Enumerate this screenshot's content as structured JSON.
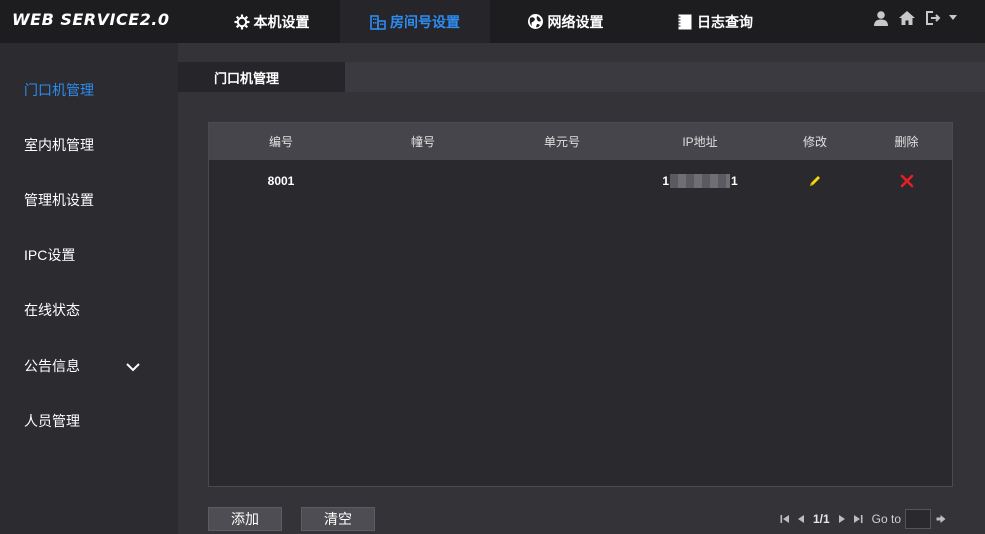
{
  "app": {
    "title": "WEB SERVICE2.0"
  },
  "topnav": [
    {
      "label": "本机设置",
      "icon": "gear-icon",
      "active": false
    },
    {
      "label": "房间号设置",
      "icon": "building-icon",
      "active": true
    },
    {
      "label": "网络设置",
      "icon": "globe-icon",
      "active": false
    },
    {
      "label": "日志查询",
      "icon": "log-icon",
      "active": false
    }
  ],
  "topright": {
    "icons": [
      "user-icon",
      "home-icon",
      "logout-icon",
      "caret-down-icon"
    ]
  },
  "sidebar": {
    "items": [
      {
        "label": "门口机管理",
        "active": true
      },
      {
        "label": "室内机管理",
        "active": false
      },
      {
        "label": "管理机设置",
        "active": false
      },
      {
        "label": "IPC设置",
        "active": false
      },
      {
        "label": "在线状态",
        "active": false
      },
      {
        "label": "公告信息",
        "active": false,
        "expandable": true
      },
      {
        "label": "人员管理",
        "active": false
      }
    ]
  },
  "main": {
    "tab": "门口机管理",
    "table": {
      "columns": [
        "编号",
        "幢号",
        "单元号",
        "IP地址",
        "修改",
        "删除"
      ],
      "rows": [
        {
          "id": "8001",
          "building": "",
          "unit": "",
          "ip_prefix": "1",
          "ip_suffix": "1"
        }
      ]
    },
    "buttons": {
      "add": "添加",
      "clear": "清空"
    },
    "pager": {
      "page": "1/1",
      "goto_label": "Go to",
      "goto_value": ""
    }
  },
  "colors": {
    "accent": "#2d8cf0",
    "edit": "#f5d90a",
    "delete": "#e81e25"
  }
}
